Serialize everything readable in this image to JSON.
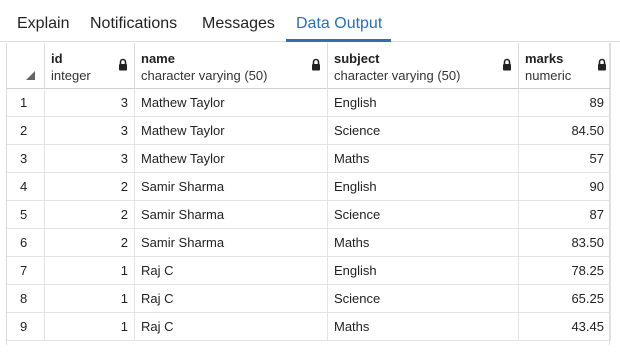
{
  "tabs": [
    {
      "label": "Explain",
      "active": false
    },
    {
      "label": "Notifications",
      "active": false
    },
    {
      "label": "Messages",
      "active": false
    },
    {
      "label": "Data Output",
      "active": true
    }
  ],
  "accent_color": "#2b6fb6",
  "columns": [
    {
      "name": "id",
      "type": "integer",
      "icon": "lock-icon"
    },
    {
      "name": "name",
      "type": "character varying (50)",
      "icon": "lock-icon"
    },
    {
      "name": "subject",
      "type": "character varying (50)",
      "icon": "lock-icon"
    },
    {
      "name": "marks",
      "type": "numeric",
      "icon": "lock-icon"
    }
  ],
  "rows": [
    {
      "n": "1",
      "id": "3",
      "name": "Mathew Taylor",
      "subject": "English",
      "marks": "89"
    },
    {
      "n": "2",
      "id": "3",
      "name": "Mathew Taylor",
      "subject": "Science",
      "marks": "84.50"
    },
    {
      "n": "3",
      "id": "3",
      "name": "Mathew Taylor",
      "subject": "Maths",
      "marks": "57"
    },
    {
      "n": "4",
      "id": "2",
      "name": "Samir Sharma",
      "subject": "English",
      "marks": "90"
    },
    {
      "n": "5",
      "id": "2",
      "name": "Samir Sharma",
      "subject": "Science",
      "marks": "87"
    },
    {
      "n": "6",
      "id": "2",
      "name": "Samir Sharma",
      "subject": "Maths",
      "marks": "83.50"
    },
    {
      "n": "7",
      "id": "1",
      "name": "Raj C",
      "subject": "English",
      "marks": "78.25"
    },
    {
      "n": "8",
      "id": "1",
      "name": "Raj C",
      "subject": "Science",
      "marks": "65.25"
    },
    {
      "n": "9",
      "id": "1",
      "name": "Raj C",
      "subject": "Maths",
      "marks": "43.45"
    }
  ]
}
